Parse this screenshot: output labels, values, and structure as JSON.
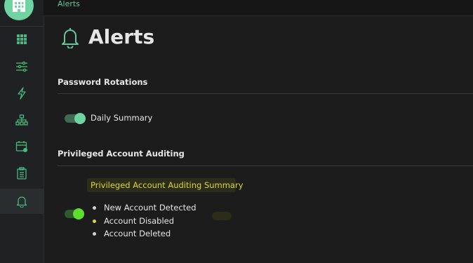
{
  "breadcrumb": "Alerts",
  "page": {
    "title": "Alerts"
  },
  "colors": {
    "accent": "#6fd3a2",
    "highlight": "#d9d63a",
    "highlight_toggle": "#5de02a"
  },
  "sidebar": {
    "logo_icon": "building-icon",
    "items": [
      {
        "icon": "grid-icon",
        "active": false
      },
      {
        "icon": "sliders-icon",
        "active": false
      },
      {
        "icon": "bolt-icon",
        "active": false
      },
      {
        "icon": "hierarchy-icon",
        "active": false
      },
      {
        "icon": "calendar-icon",
        "active": false
      },
      {
        "icon": "clipboard-icon",
        "active": false
      },
      {
        "icon": "bell-icon",
        "active": true
      }
    ]
  },
  "sections": {
    "password_rotations": {
      "title": "Password Rotations",
      "toggle": {
        "label": "Daily Summary",
        "on": true
      }
    },
    "privileged_auditing": {
      "title": "Privileged Account Auditing",
      "toggle": {
        "label": "Privileged Account Auditing Summary",
        "on": true,
        "items": [
          "New Account Detected",
          "Account Disabled",
          "Account Deleted"
        ]
      }
    }
  }
}
